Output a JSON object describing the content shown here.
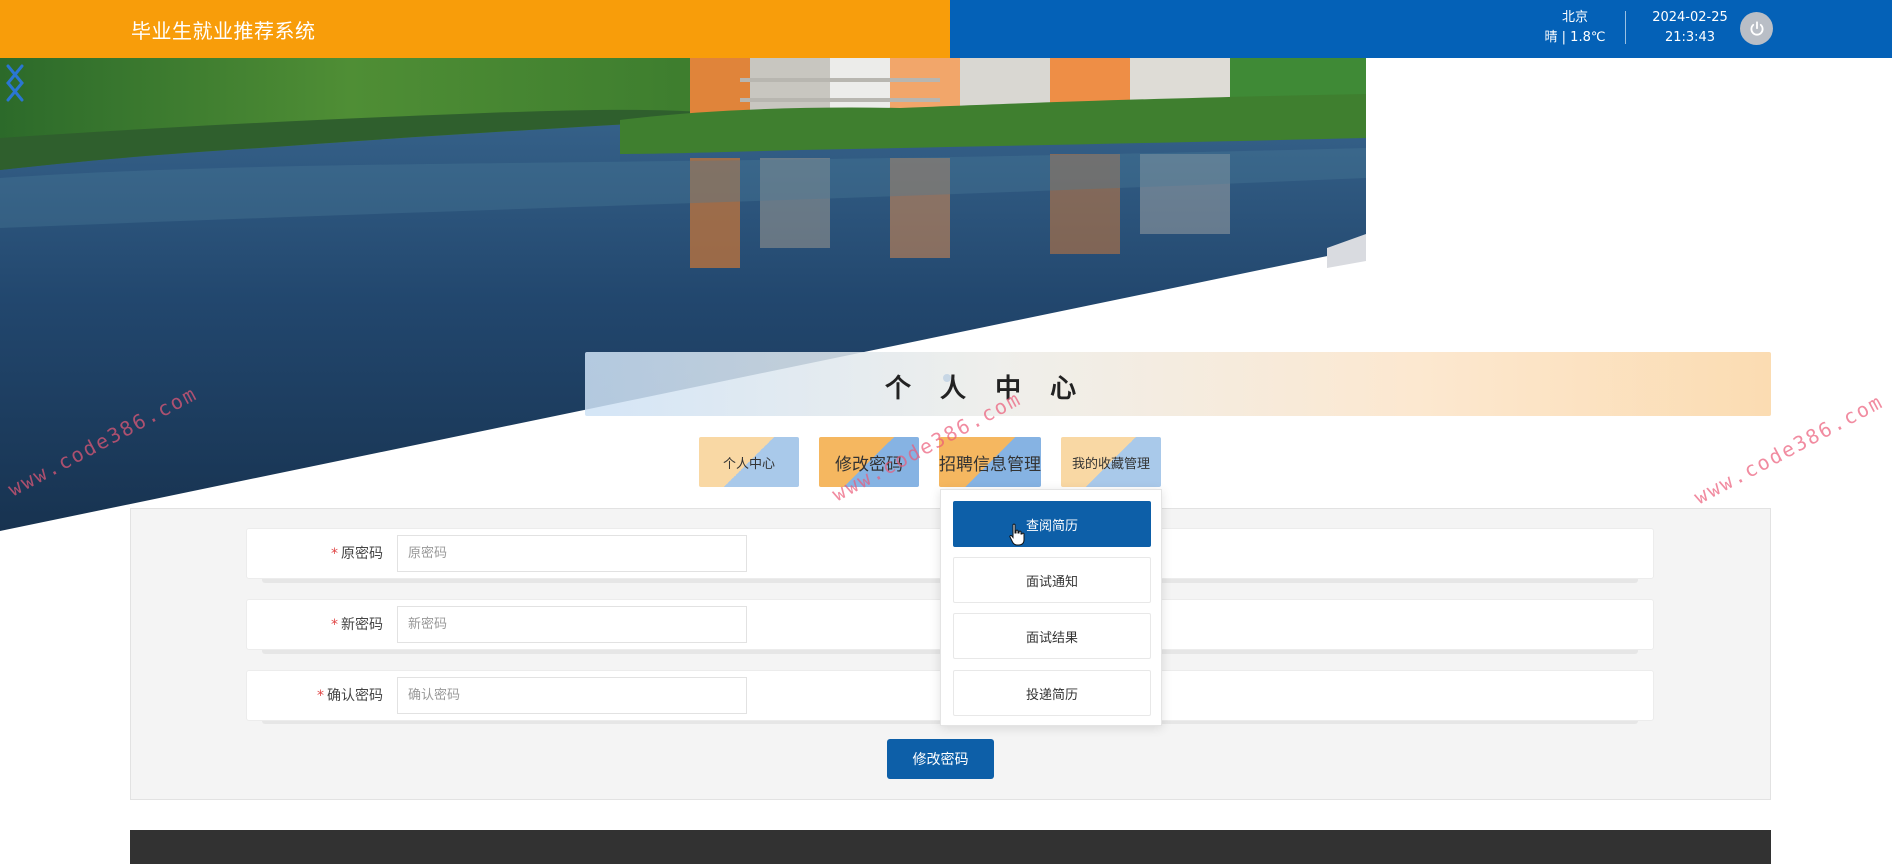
{
  "header": {
    "title": "毕业生就业推荐系统",
    "weather_city": "北京",
    "weather_desc": "晴 | 1.8℃",
    "date": "2024-02-25",
    "time": "21:3:43",
    "power_icon": "power-icon",
    "colors": {
      "left": "#f89d0a",
      "right": "#0461b7"
    }
  },
  "banner": {
    "prev_icon": "chevron-left-icon",
    "next_icon": "chevron-right-icon"
  },
  "section": {
    "title": "个 人 中 心"
  },
  "tabs": [
    {
      "label": "个人中心"
    },
    {
      "label": "修改密码"
    },
    {
      "label": "招聘信息管理"
    },
    {
      "label": "我的收藏管理"
    }
  ],
  "dropdown": {
    "items": [
      {
        "label": "查阅简历",
        "active": true
      },
      {
        "label": "面试通知"
      },
      {
        "label": "面试结果"
      },
      {
        "label": "投递简历"
      }
    ]
  },
  "form": {
    "fields": [
      {
        "label": "原密码",
        "placeholder": "原密码"
      },
      {
        "label": "新密码",
        "placeholder": "新密码"
      },
      {
        "label": "确认密码",
        "placeholder": "确认密码"
      }
    ],
    "required_mark": "*",
    "submit_label": "修改密码"
  },
  "watermark": {
    "text": "www.code386.com"
  }
}
